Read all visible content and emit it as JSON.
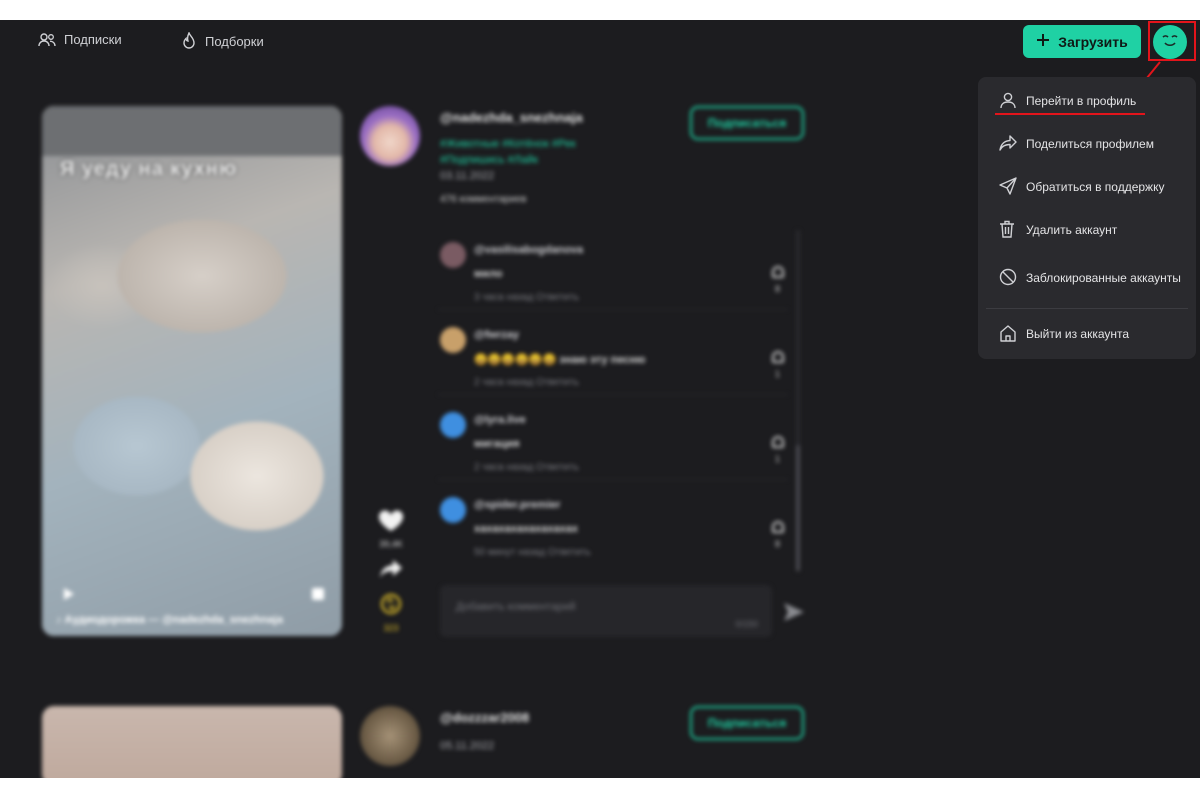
{
  "header": {
    "nav": [
      {
        "label": "Подписки",
        "icon": "users-icon"
      },
      {
        "label": "Подборки",
        "icon": "fire-icon"
      }
    ],
    "upload_label": "Загрузить",
    "accent_color": "#1fd1a4"
  },
  "post1": {
    "video_caption": "Я уеду на кухню",
    "video_audio": "♪ Аудиодорожка — @nadezhda_snezhnaja",
    "username": "@nadezhda_snezhnaja",
    "tags": [
      "#Животные",
      "#Котёнок",
      "#Рек",
      "#Подпишись",
      "#Лайк"
    ],
    "date": "03.11.2022",
    "comments_count": "476 комментариев",
    "subscribe_label": "Подписаться",
    "likes": "39,4K",
    "reposts": "323",
    "comments": [
      {
        "user": "@vasilisabogdanova",
        "text": "мило",
        "meta": "3 часа назад   Ответить",
        "likes": "8"
      },
      {
        "user": "@fwrzay",
        "text": "😄😄😄😄😄😄 знаю эту песню",
        "meta": "2 часа назад   Ответить",
        "likes": "1"
      },
      {
        "user": "@lyra.live",
        "text": "мигация",
        "meta": "2 часа назад   Ответить",
        "likes": "1"
      },
      {
        "user": "@spider.premier",
        "text": "хахахахахахахахах",
        "meta": "50 минут назад   Ответить",
        "likes": "8"
      }
    ],
    "comment_placeholder": "Добавить комментарий",
    "comment_counter": "0/150"
  },
  "post2": {
    "username": "@dozzzar2008",
    "date": "05.11.2022",
    "subscribe_label": "Подписаться"
  },
  "menu": {
    "items": [
      {
        "label": "Перейти в профиль",
        "icon": "user-icon"
      },
      {
        "label": "Поделиться профилем",
        "icon": "share-icon"
      },
      {
        "label": "Обратиться в поддержку",
        "icon": "send-icon"
      },
      {
        "label": "Удалить аккаунт",
        "icon": "trash-icon"
      },
      {
        "label": "Заблокированные аккаунты",
        "icon": "block-icon"
      },
      {
        "label": "Выйти из аккаунта",
        "icon": "home-icon"
      }
    ]
  }
}
